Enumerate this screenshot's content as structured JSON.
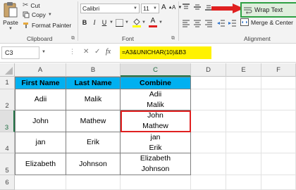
{
  "ribbon": {
    "clipboard": {
      "paste": "Paste",
      "cut": "Cut",
      "copy": "Copy",
      "format_painter": "Format Painter",
      "group": "Clipboard"
    },
    "font": {
      "name": "Calibri",
      "size": "11",
      "bold": "B",
      "italic": "I",
      "underline": "U",
      "grow": "A",
      "shrink": "A",
      "group": "Font"
    },
    "alignment": {
      "wrap_text": "Wrap Text",
      "merge_center": "Merge & Center",
      "group": "Alignment"
    }
  },
  "formula_bar": {
    "name_box": "C3",
    "cancel": "✕",
    "enter": "✓",
    "fx": "fx",
    "formula": "=A3&UNICHAR(10)&B3"
  },
  "columns": [
    "A",
    "B",
    "C",
    "D",
    "E",
    "F"
  ],
  "rows": [
    "1",
    "2",
    "3",
    "4",
    "5",
    "6"
  ],
  "table": {
    "headers": [
      "First Name",
      "Last Name",
      "Combine"
    ],
    "rows": [
      {
        "first": "Adii",
        "last": "Malik",
        "combine_1": "Adii",
        "combine_2": "Malik"
      },
      {
        "first": "John",
        "last": "Mathew",
        "combine_1": "John",
        "combine_2": "Mathew"
      },
      {
        "first": "jan",
        "last": "Erik",
        "combine_1": "jan",
        "combine_2": "Erik"
      },
      {
        "first": "Elizabeth",
        "last": "Johnson",
        "combine_1": "Elizabeth",
        "combine_2": "Johnson"
      }
    ]
  },
  "colors": {
    "header_fill": "#00b0f0",
    "formula_highlight": "#fff200",
    "annotation_red": "#e02020",
    "wrap_outline": "#2ea043",
    "excel_green": "#217346"
  }
}
